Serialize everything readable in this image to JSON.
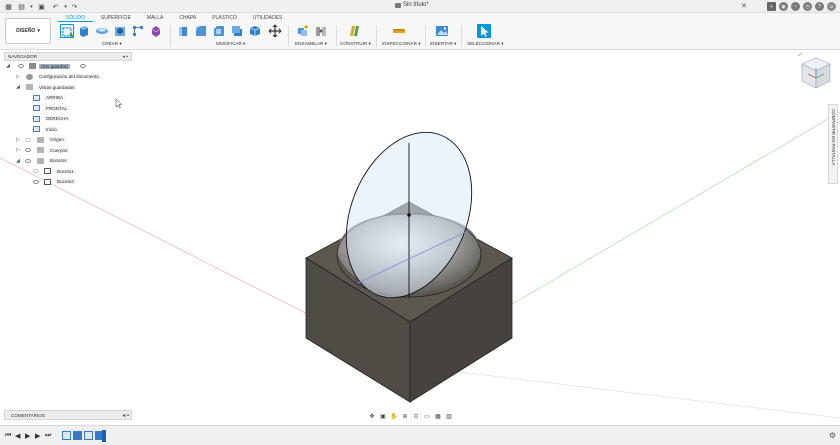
{
  "window": {
    "doc_title": "Sin título*"
  },
  "ribbon": {
    "workspace": "DISEÑO",
    "tabs": [
      "SÓLIDO",
      "SUPERFICIE",
      "MALLA",
      "CHAPA",
      "PLÁSTICO",
      "UTILIDADES"
    ],
    "active_tab": "SÓLIDO",
    "groups": {
      "crear": "CREAR",
      "modificar": "MODIFICAR",
      "ensamblar": "ENSAMBLAR",
      "construir": "CONSTRUIR",
      "inspeccionar": "INSPECCIONAR",
      "insertar": "INSERTAR",
      "seleccionar": "SELECCIONAR"
    }
  },
  "navigator": {
    "header": "NAVEGADOR",
    "root": "(Sin guardar)",
    "items": [
      {
        "label": "Configuración del documento"
      },
      {
        "label": "Vistas guardadas"
      },
      {
        "label": "ARRIBA"
      },
      {
        "label": "FRONTAL"
      },
      {
        "label": "DERECHA"
      },
      {
        "label": "Inicio"
      },
      {
        "label": "Origen"
      },
      {
        "label": "Cuerpos"
      },
      {
        "label": "Bocetos"
      },
      {
        "label": "Boceto1"
      },
      {
        "label": "Boceto2"
      }
    ]
  },
  "comments": {
    "label": "COMENTARIOS"
  },
  "side_panel": {
    "label": "COMPARTIR EN PANTALLA"
  },
  "colors": {
    "accent": "#0696d7",
    "body_top": "#5c5850",
    "body_front": "#4f4c46",
    "body_right": "#46433e",
    "plane_fill": "#dbe9f7"
  },
  "icons": {
    "app_menu": "grid-icon",
    "file": "file-icon",
    "save": "save-icon",
    "undo": "undo-icon",
    "redo": "redo-icon",
    "close": "close-icon",
    "add": "plus-icon",
    "help": "help-icon",
    "avatar": "user-icon"
  }
}
